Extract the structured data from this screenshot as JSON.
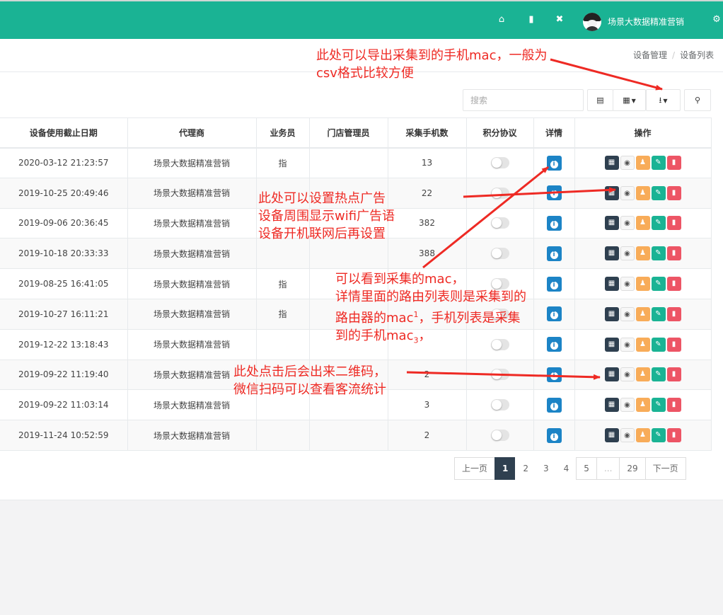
{
  "topbar": {
    "icons": [
      "home-icon",
      "trash-icon",
      "fullscreen-icon",
      "settings-icon"
    ],
    "username": "场景大数据精准营销",
    "color": "#1ab394"
  },
  "breadcrumb": {
    "items": [
      "设备管理",
      "设备列表"
    ]
  },
  "toolbar": {
    "search_placeholder": "搜索"
  },
  "table": {
    "columns": [
      "设备使用截止日期",
      "代理商",
      "业务员",
      "门店管理员",
      "采集手机数",
      "积分协议",
      "详情",
      "操作"
    ],
    "rows": [
      {
        "date": "2020-03-12 21:23:57",
        "agent": "场景大数据精准营销",
        "sales": "指",
        "manager": "",
        "count": "13"
      },
      {
        "date": "2019-10-25 20:49:46",
        "agent": "场景大数据精准营销",
        "sales": "",
        "manager": "",
        "count": "22"
      },
      {
        "date": "2019-09-06 20:36:45",
        "agent": "场景大数据精准营销",
        "sales": "",
        "manager": "",
        "count": "382"
      },
      {
        "date": "2019-10-18 20:33:33",
        "agent": "场景大数据精准营销",
        "sales": "",
        "manager": "",
        "count": "388"
      },
      {
        "date": "2019-08-25 16:41:05",
        "agent": "场景大数据精准营销",
        "sales": "指",
        "manager": "",
        "count": ""
      },
      {
        "date": "2019-10-27 16:11:21",
        "agent": "场景大数据精准营销",
        "sales": "指",
        "manager": "",
        "count": ""
      },
      {
        "date": "2019-12-22 13:18:43",
        "agent": "场景大数据精准营销",
        "sales": "",
        "manager": "",
        "count": ""
      },
      {
        "date": "2019-09-22 11:19:40",
        "agent": "场景大数据精准营销",
        "sales": "",
        "manager": "",
        "count": "2"
      },
      {
        "date": "2019-09-22 11:03:14",
        "agent": "场景大数据精准营销",
        "sales": "",
        "manager": "",
        "count": "3"
      },
      {
        "date": "2019-11-24 10:52:59",
        "agent": "场景大数据精准营销",
        "sales": "",
        "manager": "",
        "count": "2"
      }
    ]
  },
  "pagination": {
    "prev": "上一页",
    "pages": [
      "1",
      "2",
      "3",
      "4",
      "5",
      "...",
      "29"
    ],
    "active": "1",
    "next": "下一页"
  },
  "annotations": {
    "export_note": [
      "此处可以导出采集到的手机mac，一般为",
      "csv格式比较方便"
    ],
    "hotspot_note": [
      "此处可以设置热点广告",
      "设备周围显示wifi广告语",
      "设备开机联网后再设置"
    ],
    "detail_note_line1": "可以看到采集的mac，",
    "detail_note_line2": "详情里面的路由列表则是采集到的",
    "detail_note_line3a": "路由器的mac",
    "detail_note_sup1": "1",
    "detail_note_line3b": "，手机列表是采集",
    "detail_note_line4a": "到的手机mac",
    "detail_note_sub3": "3",
    "detail_note_line4b": "，",
    "qr_note": [
      "此处点击后会出来二维码，",
      "微信扫码可以查看客流统计"
    ],
    "color": "#ee2a24"
  }
}
